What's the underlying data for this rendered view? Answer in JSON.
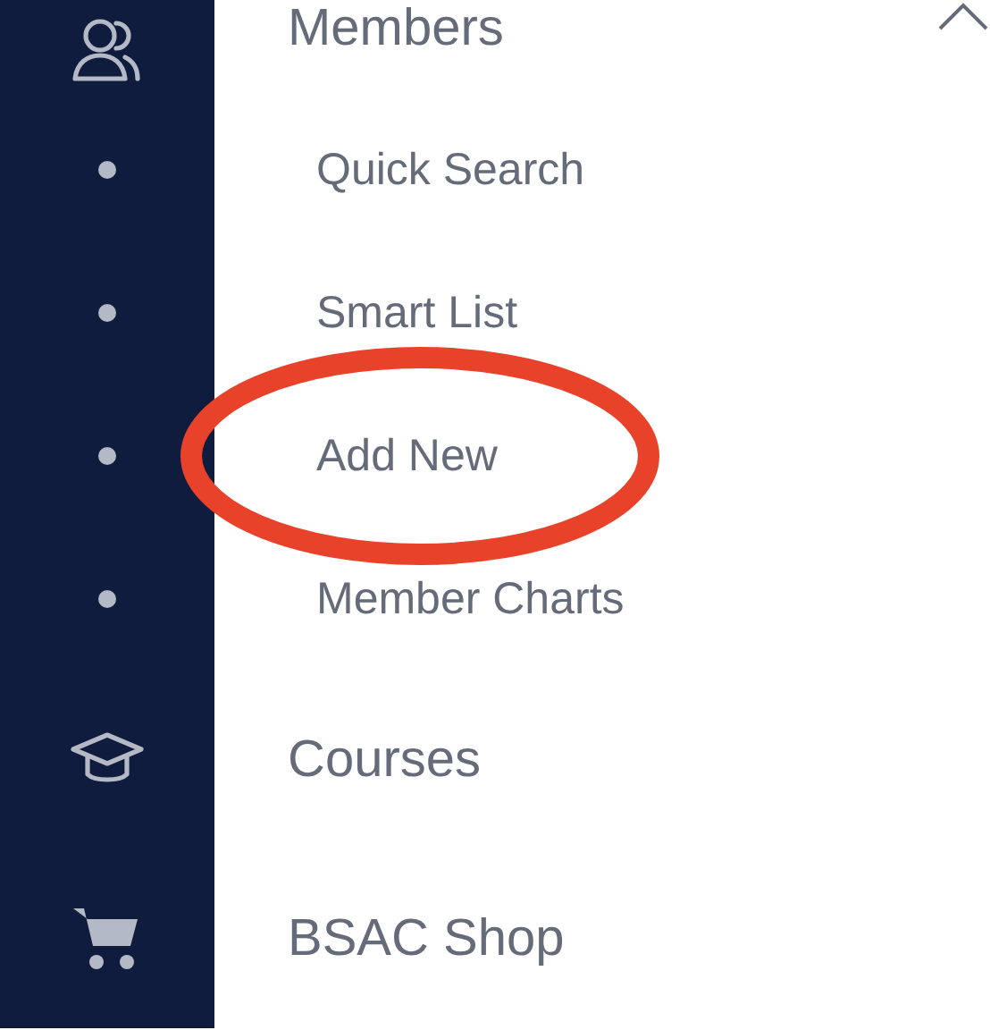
{
  "menu": [
    {
      "label": "Members",
      "kind": "person",
      "expanded": true,
      "children": [
        {
          "label": "Quick Search"
        },
        {
          "label": "Smart List"
        },
        {
          "label": "Add New"
        },
        {
          "label": "Member Charts"
        }
      ]
    },
    {
      "label": "Courses",
      "kind": "cap"
    },
    {
      "label": "BSAC Shop",
      "kind": "cart"
    }
  ]
}
